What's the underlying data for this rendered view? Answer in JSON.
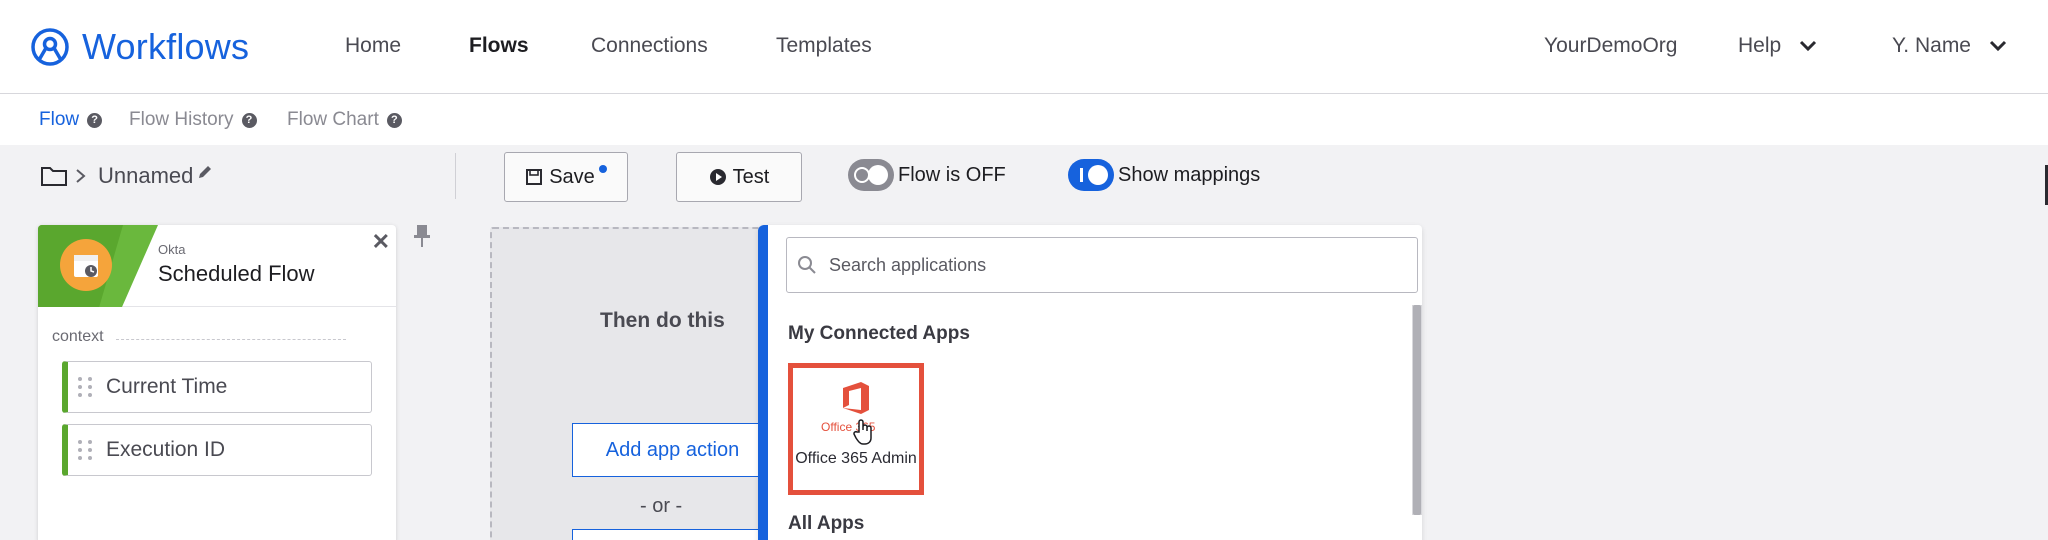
{
  "app": {
    "name": "Workflows",
    "brand_color": "#1662dd"
  },
  "nav": {
    "items": [
      {
        "label": "Home"
      },
      {
        "label": "Flows"
      },
      {
        "label": "Connections"
      },
      {
        "label": "Templates"
      }
    ],
    "org": "YourDemoOrg",
    "help": "Help",
    "user": "Y. Name"
  },
  "subtabs": [
    {
      "label": "Flow"
    },
    {
      "label": "Flow History"
    },
    {
      "label": "Flow Chart"
    }
  ],
  "toolbar": {
    "flow_name": "Unnamed",
    "save_label": "Save",
    "test_label": "Test",
    "flow_toggle_label": "Flow is OFF",
    "mappings_toggle_label": "Show mappings"
  },
  "event_card": {
    "provider": "Okta",
    "title": "Scheduled Flow",
    "context_label": "context",
    "fields": [
      "Current Time",
      "Execution ID"
    ]
  },
  "action_zone": {
    "heading": "Then do this",
    "add_action_label": "Add app action",
    "or_label": "- or -"
  },
  "picker": {
    "search_placeholder": "Search applications",
    "connected_title": "My Connected Apps",
    "all_apps_title": "All Apps",
    "apps": [
      {
        "name": "Office 365 Admin",
        "logo_caption": "Office 365",
        "icon": "office-365-icon",
        "color": "#e4503c"
      }
    ]
  }
}
